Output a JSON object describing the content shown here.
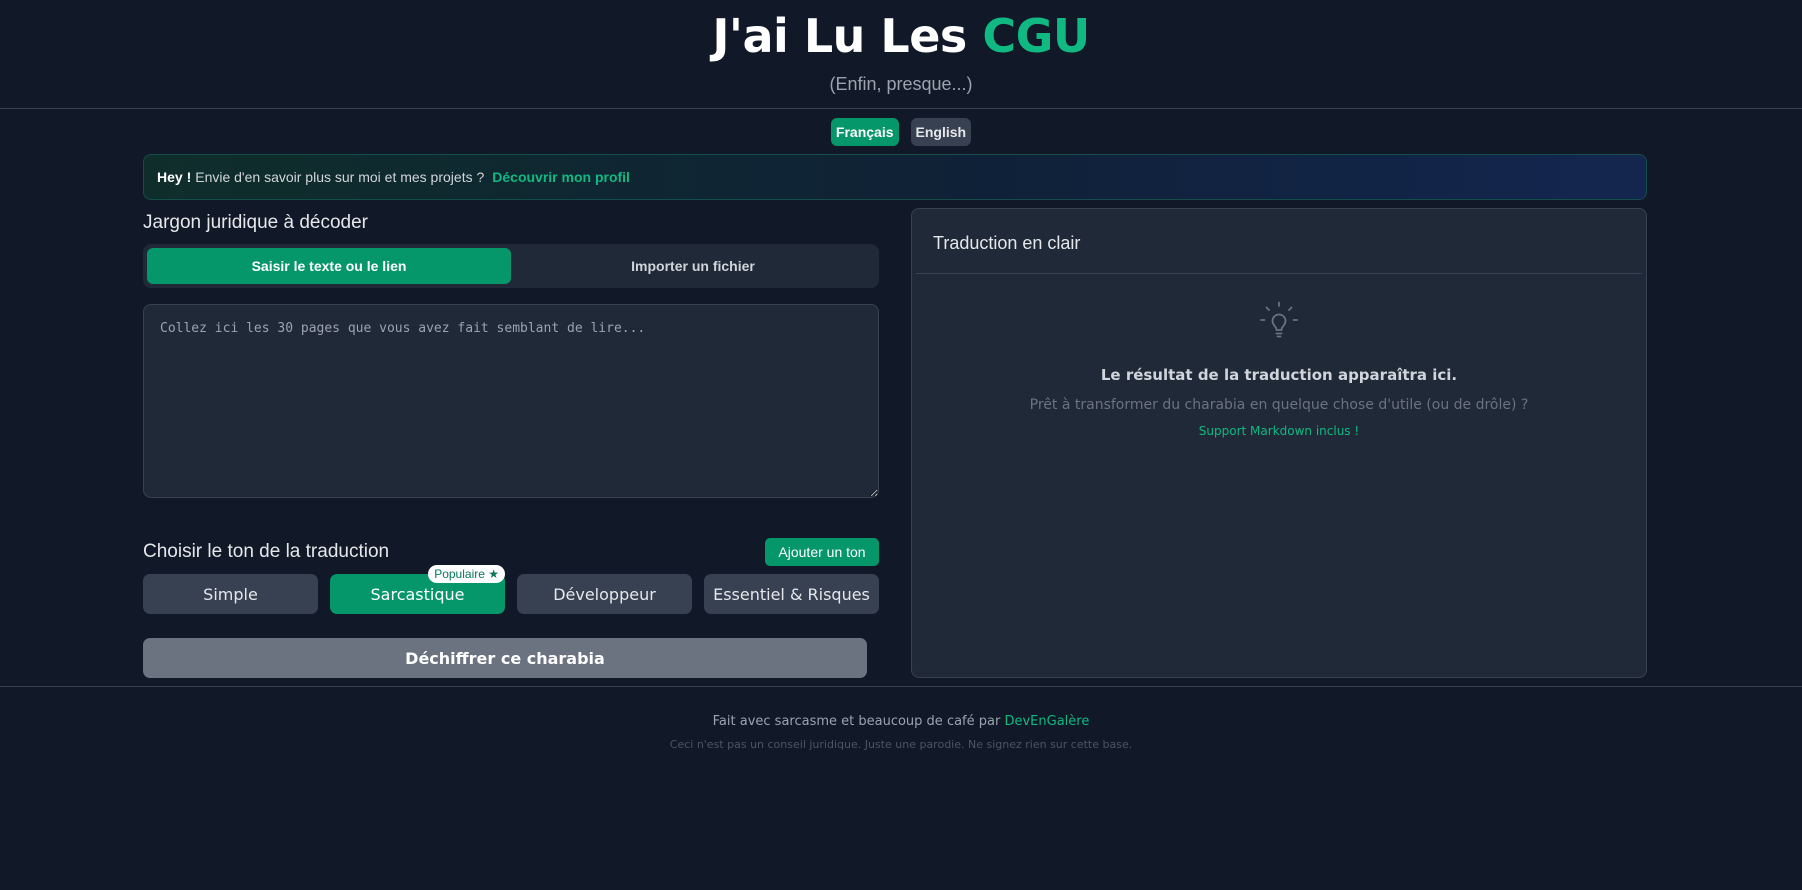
{
  "header": {
    "title_main": "J'ai Lu Les ",
    "title_accent": "CGU",
    "subtitle": "(Enfin, presque...)"
  },
  "languages": [
    {
      "label": "Français",
      "active": true
    },
    {
      "label": "English",
      "active": false
    }
  ],
  "banner": {
    "greeting": "Hey !",
    "text": "Envie d'en savoir plus sur moi et mes projets ?",
    "link": "Découvrir mon profil"
  },
  "input": {
    "title": "Jargon juridique à décoder",
    "tabs": [
      {
        "label": "Saisir le texte ou le lien",
        "active": true
      },
      {
        "label": "Importer un fichier",
        "active": false
      }
    ],
    "placeholder": "Collez ici les 30 pages que vous avez fait semblant de lire...",
    "value": ""
  },
  "tone": {
    "title": "Choisir le ton de la traduction",
    "add_label": "Ajouter un ton",
    "options": [
      {
        "label": "Simple",
        "active": false
      },
      {
        "label": "Sarcastique",
        "active": true
      },
      {
        "label": "Développeur",
        "active": false
      },
      {
        "label": "Essentiel & Risques",
        "active": false
      }
    ],
    "popular_badge": "Populaire ★"
  },
  "decode_label": "Déchiffrer ce charabia",
  "output": {
    "title": "Traduction en clair",
    "icon": "lightbulb-icon",
    "empty_title": "Le résultat de la traduction apparaîtra ici.",
    "empty_sub": "Prêt à transformer du charabia en quelque chose d'utile (ou de drôle) ?",
    "markdown_note": "Support Markdown inclus !"
  },
  "footer": {
    "text": "Fait avec sarcasme et beaucoup de café par",
    "author": "DevEnGalère",
    "disclaimer": "Ceci n'est pas un conseil juridique. Juste une parodie. Ne signez rien sur cette base."
  },
  "colors": {
    "background": "#111827",
    "panel": "#1f2937",
    "accent": "#10b981",
    "accent_button": "#059669",
    "muted_button": "#374151",
    "disabled_button": "#6b7280"
  }
}
